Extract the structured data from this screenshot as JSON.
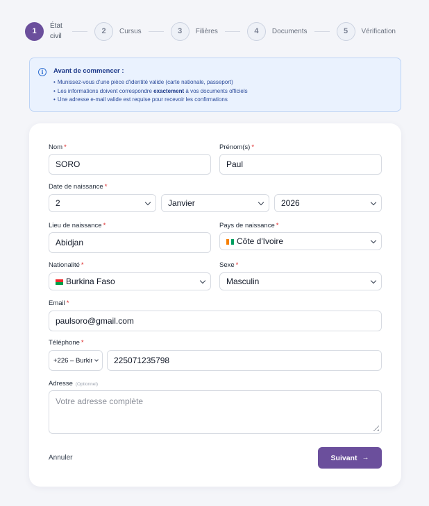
{
  "stepper": {
    "steps": [
      {
        "number": "1",
        "label": "État civil"
      },
      {
        "number": "2",
        "label": "Cursus"
      },
      {
        "number": "3",
        "label": "Filières"
      },
      {
        "number": "4",
        "label": "Documents"
      },
      {
        "number": "5",
        "label": "Vérification"
      }
    ]
  },
  "info": {
    "title": "Avant de commencer :",
    "items": [
      "Munissez-vous d'une pièce d'identité valide (carte nationale, passeport)",
      "Les informations doivent correspondre",
      "exactement",
      "à vos documents officiels",
      "Une adresse e-mail valide est requise pour recevoir les confirmations"
    ]
  },
  "form": {
    "nom": {
      "label": "Nom",
      "value": "SORO"
    },
    "prenom": {
      "label": "Prénom(s)",
      "value": "Paul"
    },
    "dob": {
      "label": "Date de naissance",
      "day": "2",
      "month": "Janvier",
      "year": "2026"
    },
    "lieu": {
      "label": "Lieu de naissance",
      "value": "Abidjan"
    },
    "pays": {
      "label": "Pays de naissance",
      "value": "Côte d'Ivoire"
    },
    "nationalite": {
      "label": "Nationalité",
      "value": "Burkina Faso"
    },
    "sexe": {
      "label": "Sexe",
      "value": "Masculin"
    },
    "email": {
      "label": "Email",
      "value": "paulsoro@gmail.com"
    },
    "telephone": {
      "label": "Téléphone",
      "code": "+226 – Burkir",
      "value": "225071235798"
    },
    "adresse": {
      "label": "Adresse",
      "optional": "(Optionnel)",
      "placeholder": "Votre adresse complète"
    },
    "required_mark": "*"
  },
  "actions": {
    "cancel": "Annuler",
    "next": "Suivant",
    "next_arrow": "→"
  },
  "colors": {
    "accent": "#6b4f9c",
    "required": "#dc2626",
    "info_bg": "#eaf2fe"
  }
}
